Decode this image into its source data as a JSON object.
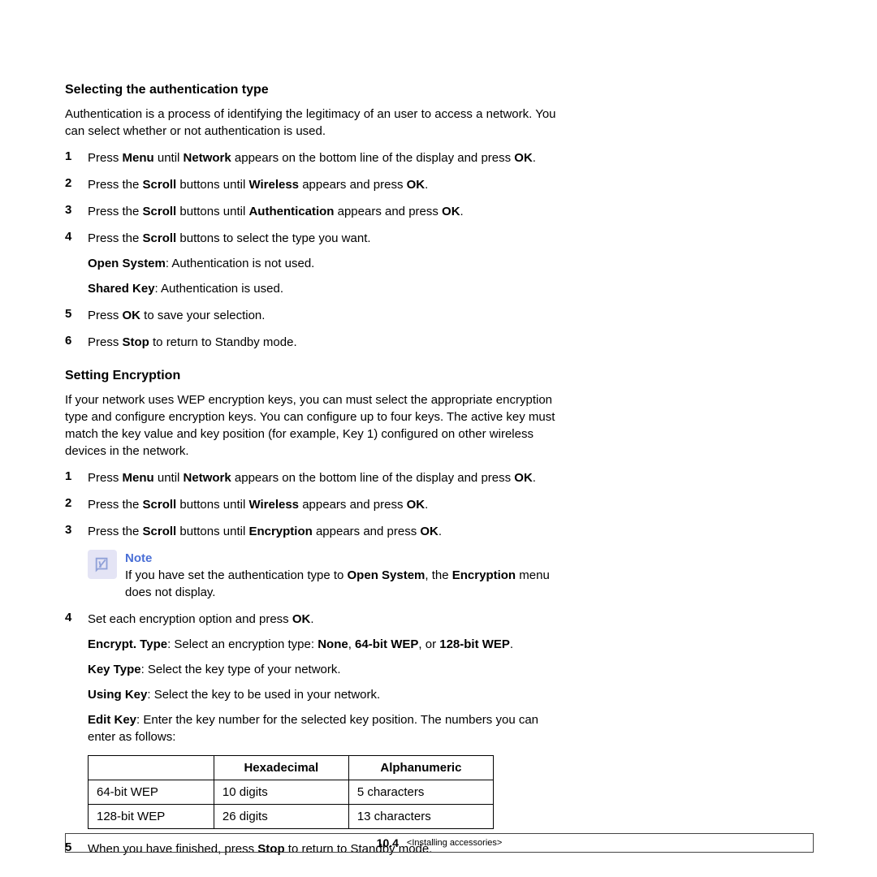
{
  "section1": {
    "heading": "Selecting the authentication type",
    "intro": "Authentication is a process of identifying the legitimacy of an user to access a network. You can select whether or not authentication is used.",
    "steps": [
      {
        "num": "1",
        "pre": "Press ",
        "b1": "Menu",
        "mid1": " until ",
        "b2": "Network",
        "mid2": " appears on the bottom line of the display and press ",
        "b3": "OK",
        "post": "."
      },
      {
        "num": "2",
        "pre": "Press the ",
        "b1": "Scroll",
        "mid1": " buttons until ",
        "b2": "Wireless",
        "mid2": " appears and press ",
        "b3": "OK",
        "post": "."
      },
      {
        "num": "3",
        "pre": "Press the ",
        "b1": "Scroll",
        "mid1": " buttons until ",
        "b2": "Authentication",
        "mid2": " appears and press ",
        "b3": "OK",
        "post": "."
      }
    ],
    "step4": {
      "num": "4",
      "pre": "Press the ",
      "b1": "Scroll",
      "post": " buttons to select the type you want.",
      "opt1_b": "Open System",
      "opt1_t": ": Authentication is not used.",
      "opt2_b": "Shared Key",
      "opt2_t": ": Authentication is used."
    },
    "step5": {
      "num": "5",
      "pre": "Press ",
      "b1": "OK",
      "post": " to save your selection."
    },
    "step6": {
      "num": "6",
      "pre": "Press ",
      "b1": "Stop",
      "post": " to return to Standby mode."
    }
  },
  "section2": {
    "heading": "Setting Encryption",
    "intro": "If your network uses WEP encryption keys, you can must select the appropriate encryption type and configure encryption keys. You can configure up to four keys. The active key must match the key value and key position (for example, Key 1) configured on other wireless devices in the network.",
    "steps": [
      {
        "num": "1",
        "pre": "Press ",
        "b1": "Menu",
        "mid1": " until ",
        "b2": "Network",
        "mid2": " appears on the bottom line of the display and press ",
        "b3": "OK",
        "post": "."
      },
      {
        "num": "2",
        "pre": "Press the ",
        "b1": "Scroll",
        "mid1": " buttons until ",
        "b2": "Wireless",
        "mid2": " appears and press ",
        "b3": "OK",
        "post": "."
      },
      {
        "num": "3",
        "pre": "Press the ",
        "b1": "Scroll",
        "mid1": " buttons until ",
        "b2": "Encryption",
        "mid2": " appears and press ",
        "b3": "OK",
        "post": "."
      }
    ],
    "note": {
      "label": "Note",
      "pre": "If you have set the authentication type to ",
      "b1": "Open System",
      "mid": ", the ",
      "b2": "Encryption",
      "post": " menu does not display."
    },
    "step4": {
      "num": "4",
      "pre": "Set each encryption option and press ",
      "b1": "OK",
      "post": ".",
      "l1b": "Encrypt. Type",
      "l1t1": ": Select an encryption type: ",
      "l1b2": "None",
      "l1c": ", ",
      "l1b3": "64-bit WEP",
      "l1t2": ", or ",
      "l1b4": "128-bit WEP",
      "l1t3": ".",
      "l2b": "Key Type",
      "l2t": ": Select the key type of your network.",
      "l3b": "Using Key",
      "l3t": ": Select the key to be used in your network.",
      "l4b": "Edit Key",
      "l4t": ": Enter the key number for the selected key position. The numbers you can enter as follows:"
    },
    "table": {
      "h1": "",
      "h2": "Hexadecimal",
      "h3": "Alphanumeric",
      "r1": {
        "c1": "64-bit WEP",
        "c2": "10 digits",
        "c3": "5 characters"
      },
      "r2": {
        "c1": "128-bit WEP",
        "c2": "26 digits",
        "c3": "13 characters"
      }
    },
    "step5": {
      "num": "5",
      "pre": "When you have finished, press ",
      "b1": "Stop",
      "post": " to return to Standby mode."
    }
  },
  "footer": {
    "page_prefix": "10",
    "page_suffix": ".4",
    "crumb": "<Installing accessories>"
  }
}
